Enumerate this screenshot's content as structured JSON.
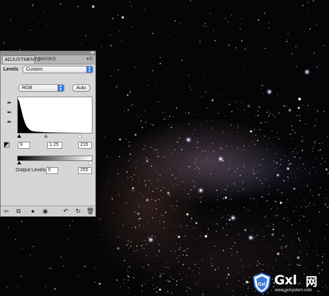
{
  "panel": {
    "tabs": [
      "ADJUSTMENTS",
      "MASKS"
    ],
    "menu_icon": "panel-menu-icon",
    "levels_label": "Levels",
    "preset_value": "Custom",
    "channel_value": "RGB",
    "auto_label": "Auto",
    "input_levels": {
      "black": "9",
      "gamma": "1.25",
      "white": "215"
    },
    "output_label": "Output Levels:",
    "output_levels": {
      "black": "0",
      "white": "255"
    },
    "eyedroppers": [
      "black-point-eyedropper-icon",
      "gray-point-eyedropper-icon",
      "white-point-eyedropper-icon"
    ],
    "bottom_icons": [
      "return-to-list-icon",
      "expand-view-icon",
      "clip-to-layer-icon",
      "visibility-eye-icon",
      "view-previous-state-icon",
      "reset-icon",
      "delete-icon"
    ]
  },
  "watermark": {
    "brand": "Gxl",
    "chinese": "网",
    "url": "www.gxlsystem.com",
    "shield_text": "Gxl"
  },
  "colors": {
    "panel_bg": "#d6d6d6",
    "accent_blue": "#3b78d8",
    "canvas_bg": "#050507"
  }
}
